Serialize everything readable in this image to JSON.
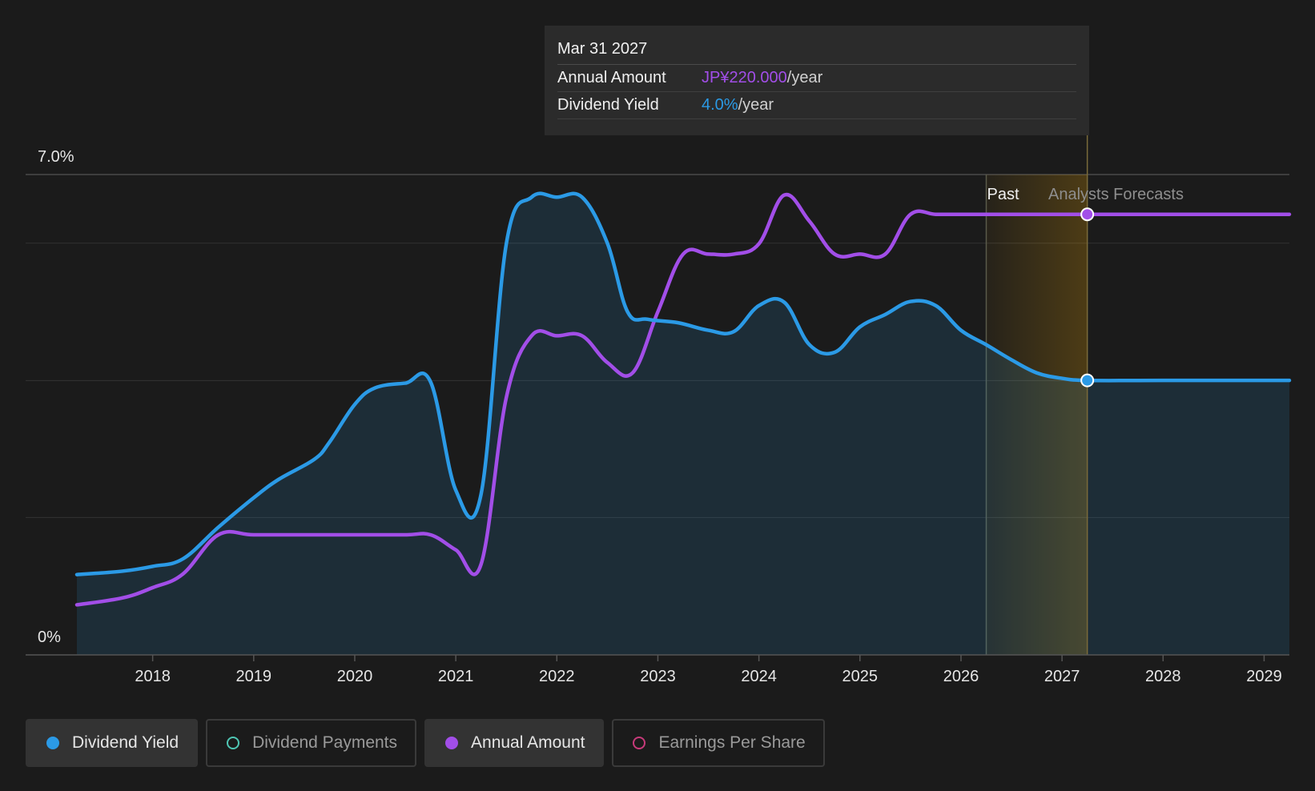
{
  "tooltip": {
    "date": "Mar 31 2027",
    "rows": [
      {
        "label": "Annual Amount",
        "value": "JP¥220.000",
        "suffix": "/year",
        "color": "#a24ee8"
      },
      {
        "label": "Dividend Yield",
        "value": "4.0%",
        "suffix": "/year",
        "color": "#2b9ae6"
      }
    ]
  },
  "region_labels": {
    "past": "Past",
    "forecast": "Analysts Forecasts"
  },
  "legend": [
    {
      "label": "Dividend Yield",
      "color": "#2b9ae6",
      "active": true,
      "icon": "filled-circle-icon"
    },
    {
      "label": "Dividend Payments",
      "color": "#4fc6b4",
      "active": false,
      "icon": "hollow-circle-icon"
    },
    {
      "label": "Annual Amount",
      "color": "#a24ee8",
      "active": true,
      "icon": "filled-circle-icon"
    },
    {
      "label": "Earnings Per Share",
      "color": "#c73a7a",
      "active": false,
      "icon": "hollow-circle-icon"
    }
  ],
  "chart_data": {
    "type": "area",
    "title": "",
    "ylim": [
      0,
      7.0
    ],
    "y_tick_labels": [
      "0%",
      "7.0%"
    ],
    "xlim": [
      2017.25,
      2029.25
    ],
    "x_tick_labels": [
      "2018",
      "2019",
      "2020",
      "2021",
      "2022",
      "2023",
      "2024",
      "2025",
      "2026",
      "2027",
      "2028",
      "2029"
    ],
    "past_forecast_boundary": 2026.25,
    "selected_x": 2027.25,
    "series": [
      {
        "name": "Dividend Yield",
        "color": "#2b9ae6",
        "filled": true,
        "x": [
          2017.25,
          2017.7,
          2018.0,
          2018.3,
          2018.65,
          2019.0,
          2019.25,
          2019.6,
          2019.75,
          2020.0,
          2020.2,
          2020.5,
          2020.75,
          2021.0,
          2021.25,
          2021.5,
          2021.75,
          2022.0,
          2022.25,
          2022.5,
          2022.7,
          2022.9,
          2023.2,
          2023.5,
          2023.75,
          2024.0,
          2024.25,
          2024.5,
          2024.75,
          2025.0,
          2025.25,
          2025.5,
          2025.75,
          2026.0,
          2026.25,
          2026.5,
          2026.75,
          2027.0,
          2027.25,
          2028.0,
          2029.25
        ],
        "values": [
          1.17,
          1.22,
          1.29,
          1.4,
          1.86,
          2.29,
          2.56,
          2.85,
          3.1,
          3.65,
          3.89,
          3.96,
          3.98,
          2.4,
          2.34,
          5.99,
          6.67,
          6.67,
          6.67,
          6.0,
          5.0,
          4.89,
          4.84,
          4.73,
          4.71,
          5.09,
          5.14,
          4.52,
          4.41,
          4.78,
          4.96,
          5.15,
          5.09,
          4.73,
          4.52,
          4.3,
          4.11,
          4.03,
          4.0,
          4.0,
          4.0
        ]
      },
      {
        "name": "Annual Amount",
        "color": "#a24ee8",
        "filled": false,
        "x": [
          2017.25,
          2017.7,
          2018.0,
          2018.3,
          2018.65,
          2019.0,
          2019.5,
          2020.0,
          2020.5,
          2020.75,
          2021.0,
          2021.25,
          2021.5,
          2021.75,
          2022.0,
          2022.25,
          2022.5,
          2022.75,
          2023.0,
          2023.25,
          2023.5,
          2023.75,
          2024.0,
          2024.25,
          2024.5,
          2024.75,
          2025.0,
          2025.25,
          2025.5,
          2025.75,
          2026.0,
          2026.25,
          2026.75,
          2027.25,
          2028.0,
          2029.25
        ],
        "values": [
          0.73,
          0.83,
          0.98,
          1.18,
          1.75,
          1.75,
          1.75,
          1.75,
          1.75,
          1.75,
          1.53,
          1.32,
          3.75,
          4.65,
          4.65,
          4.65,
          4.26,
          4.11,
          5.0,
          5.84,
          5.84,
          5.84,
          5.99,
          6.7,
          6.32,
          5.84,
          5.84,
          5.84,
          6.42,
          6.42,
          6.42,
          6.42,
          6.42,
          6.42,
          6.42,
          6.42
        ]
      }
    ]
  }
}
